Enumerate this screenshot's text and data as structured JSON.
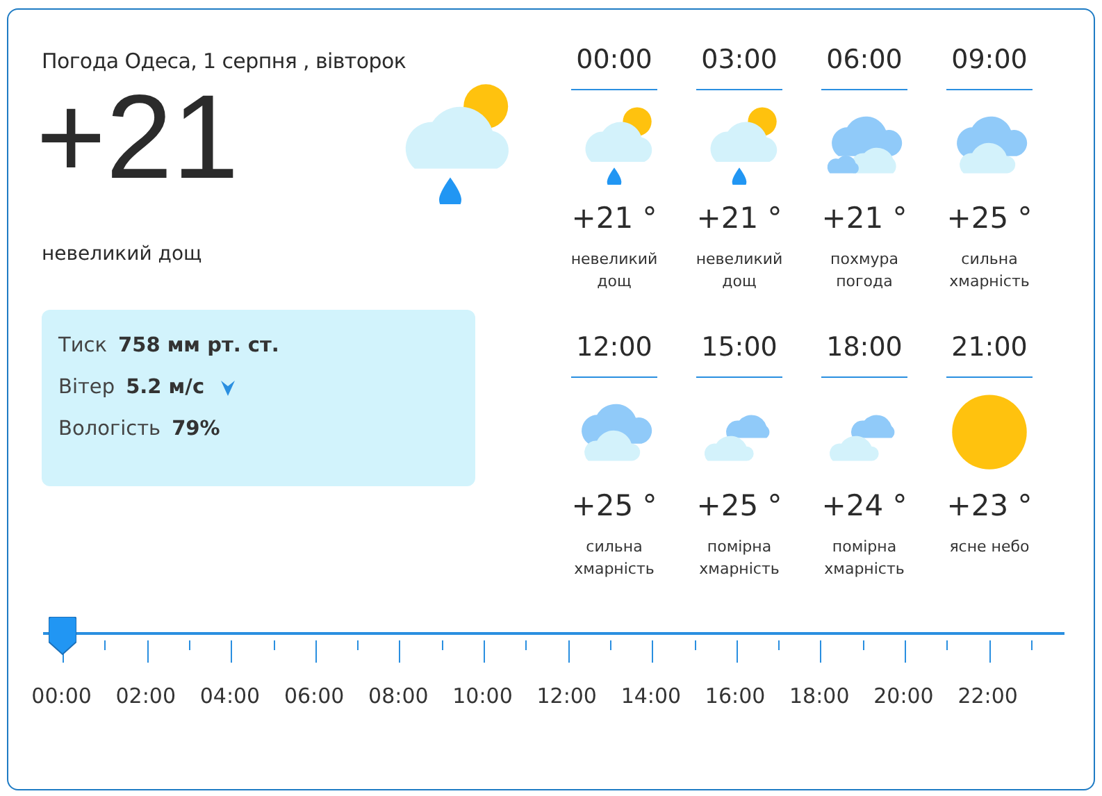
{
  "current": {
    "title": "Погода Одеса, 1 серпня , вівторок",
    "temperature": "+21",
    "kind": "rain-sun",
    "description": "невеликий дощ",
    "details": [
      {
        "label": "Тиск",
        "value": "758 мм рт. ст.",
        "kind": "plain"
      },
      {
        "label": "Вітер",
        "value": "5.2 м/с",
        "kind": "wind"
      },
      {
        "label": "Вологість",
        "value": "79%",
        "kind": "plain"
      }
    ]
  },
  "hourly": [
    {
      "time": "00:00",
      "kind": "rain-sun",
      "temperature": "+21 °",
      "description": "невеликий дощ"
    },
    {
      "time": "03:00",
      "kind": "rain-sun",
      "temperature": "+21 °",
      "description": "невеликий дощ"
    },
    {
      "time": "06:00",
      "kind": "overcast",
      "temperature": "+21 °",
      "description": "похмура погода"
    },
    {
      "time": "09:00",
      "kind": "heavy-clouds",
      "temperature": "+25 °",
      "description": "сильна хмарність"
    },
    {
      "time": "12:00",
      "kind": "heavy-clouds",
      "temperature": "+25 °",
      "description": "сильна хмарність"
    },
    {
      "time": "15:00",
      "kind": "partly-cloudy",
      "temperature": "+25 °",
      "description": "помірна хмарність"
    },
    {
      "time": "18:00",
      "kind": "partly-cloudy",
      "temperature": "+24 °",
      "description": "помірна хмарність"
    },
    {
      "time": "21:00",
      "kind": "sun",
      "temperature": "+23 °",
      "description": "ясне небо"
    }
  ],
  "timeline": {
    "level": 0,
    "labels": [
      "00:00",
      "02:00",
      "04:00",
      "06:00",
      "08:00",
      "10:00",
      "12:00",
      "14:00",
      "16:00",
      "18:00",
      "20:00",
      "22:00"
    ]
  }
}
